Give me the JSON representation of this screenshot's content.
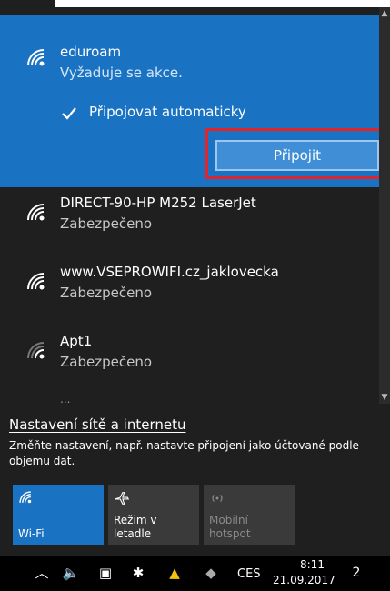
{
  "networks": {
    "active": {
      "name": "eduroam",
      "status": "Vyžaduje se akce.",
      "auto_label": "Připojovat automaticky",
      "auto_checked": true,
      "connect_label": "Připojit"
    },
    "items": [
      {
        "name": "DIRECT-90-HP M252 LaserJet",
        "status": "Zabezpečeno"
      },
      {
        "name": "www.VSEPROWIFI.cz_jaklovecka",
        "status": "Zabezpečeno"
      },
      {
        "name": "Apt1",
        "status": "Zabezpečeno"
      }
    ],
    "partial_item": "..."
  },
  "settings": {
    "link_label": "Nastavení sítě a internetu",
    "description": "Změňte nastavení, např. nastavte připojení jako účtované podle objemu dat."
  },
  "tiles": {
    "wifi": {
      "label": "Wi-Fi",
      "icon": "wifi-icon",
      "active": true
    },
    "airplane": {
      "label_line1": "Režim v",
      "label_line2": "letadle",
      "icon": "airplane-icon",
      "active": false
    },
    "hotspot": {
      "label_line1": "Mobilní",
      "label_line2": "hotspot",
      "icon": "hotspot-icon",
      "active": false
    }
  },
  "taskbar": {
    "language": "CES",
    "time": "8:11",
    "date": "21.09.2017",
    "notifications_count": "2"
  },
  "colors": {
    "accent": "#1a73c2",
    "flyout_bg": "#1f1f1f",
    "highlight_box": "#e0242a"
  }
}
